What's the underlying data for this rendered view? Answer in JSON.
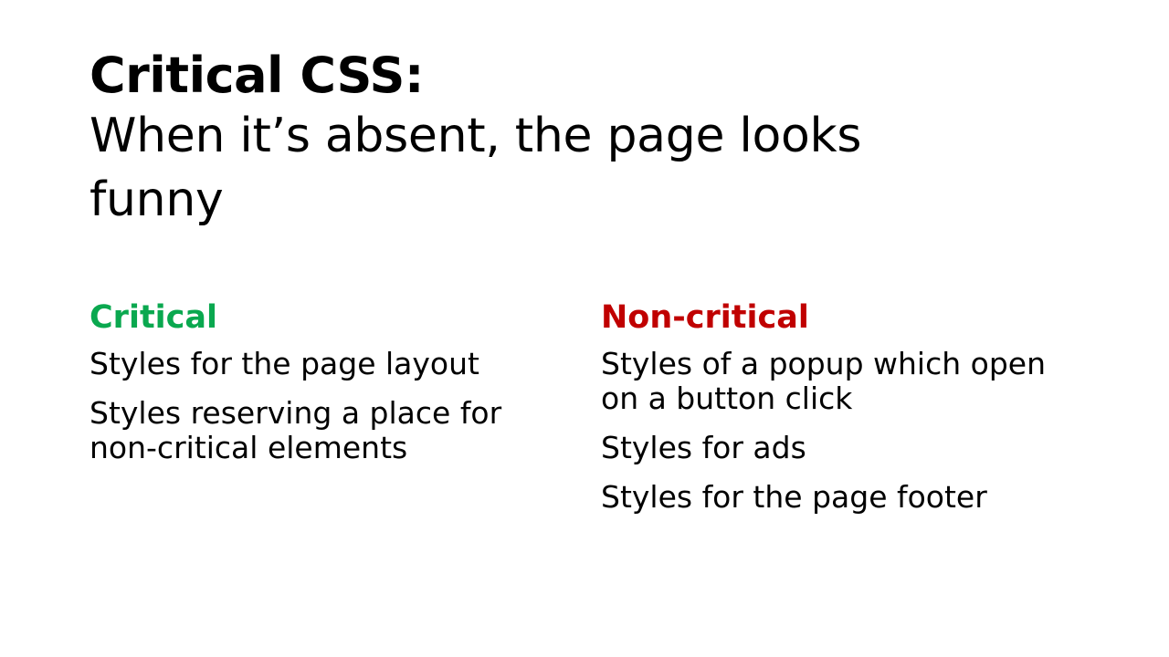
{
  "slide": {
    "title": "Critical CSS:",
    "subtitle": "When it’s absent, the page looks funny"
  },
  "critical": {
    "heading": "Critical",
    "color": "#0aa84f",
    "items": [
      "Styles for the page layout",
      "Styles reserving a place for non-critical elements"
    ]
  },
  "non_critical": {
    "heading": "Non-critical",
    "color": "#c00000",
    "items": [
      "Styles of a popup which open on a button click",
      "Styles for ads",
      "Styles for the page footer"
    ]
  }
}
